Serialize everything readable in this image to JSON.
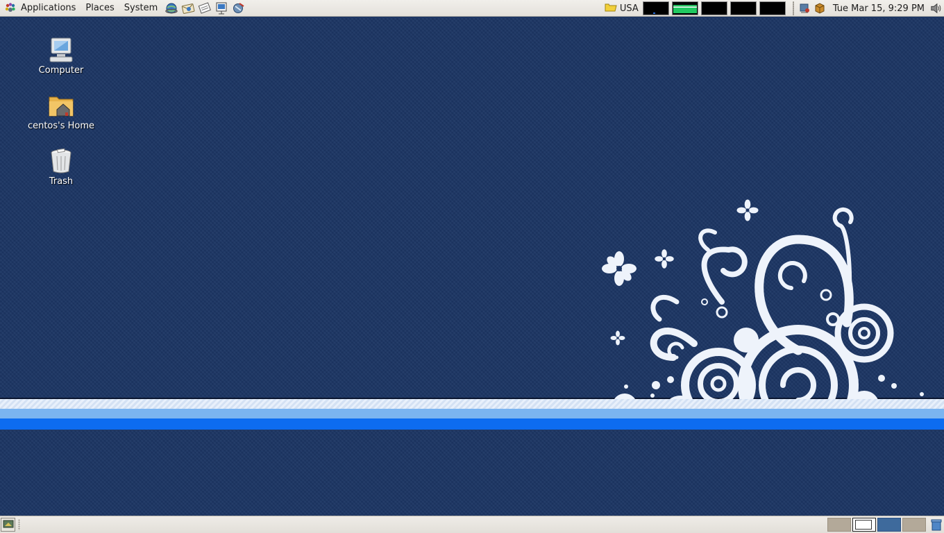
{
  "top_panel": {
    "menus": {
      "applications": "Applications",
      "places": "Places",
      "system": "System"
    },
    "launchers": [
      "web-browser-icon",
      "email-icon",
      "notes-icon",
      "presentation-icon",
      "network-icon"
    ],
    "keyboard_layout": "USA",
    "system_monitors": [
      "cpu",
      "memory",
      "network",
      "swap",
      "load"
    ],
    "clock": "Tue Mar 15,  9:29 PM",
    "tray": [
      "network-manager-icon",
      "package-updater-icon",
      "volume-icon"
    ]
  },
  "desktop": {
    "icons": [
      {
        "label": "Computer",
        "icon": "computer-icon"
      },
      {
        "label": "centos's Home",
        "icon": "home-folder-icon"
      },
      {
        "label": "Trash",
        "icon": "trash-icon"
      }
    ]
  },
  "colors": {
    "wallpaper": "#1c3563",
    "stripe_blue": "#0d6cf0",
    "stripe_light": "#7bb4f0",
    "panel": "#ebe8e3",
    "workspace_active": "#3e6a9c"
  },
  "bottom_panel": {
    "workspaces": [
      "1",
      "2",
      "3",
      "4"
    ],
    "current_workspace": "2"
  }
}
